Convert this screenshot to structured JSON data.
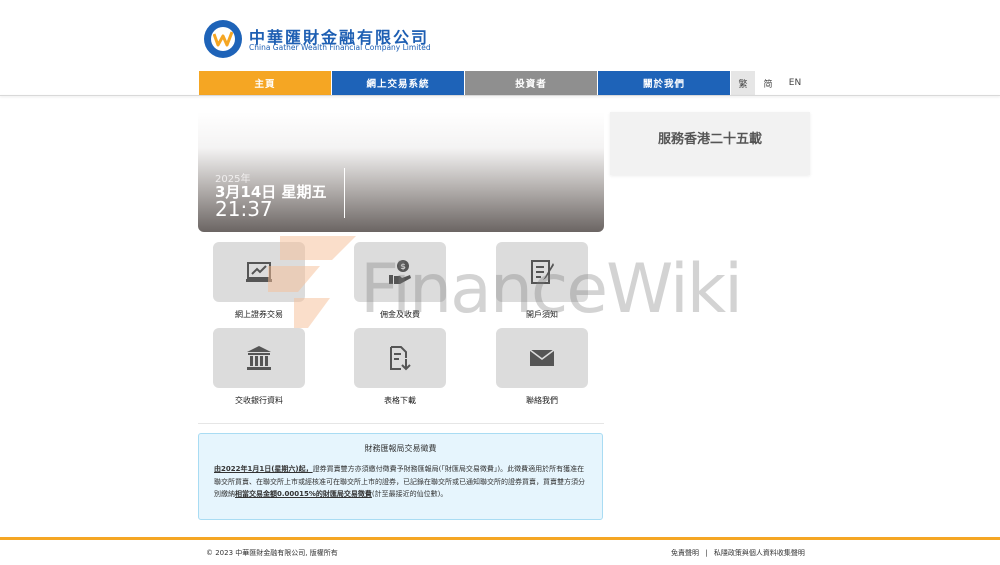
{
  "header": {
    "company_cn": "中華匯財金融有限公司",
    "company_en": "China Gather Wealth Financial Company Limited"
  },
  "nav": {
    "items": [
      {
        "label": "主頁",
        "color": "#f5a623"
      },
      {
        "label": "網上交易系統",
        "color": "#1e63b8"
      },
      {
        "label": "投資者",
        "color": "#8f8f8f"
      },
      {
        "label": "關於我們",
        "color": "#1e63b8"
      }
    ],
    "languages": [
      "繁",
      "简",
      "EN"
    ]
  },
  "hero": {
    "year": "2025年",
    "date": "3月14日 星期五",
    "time": "21:37"
  },
  "side": {
    "title": "服務香港二十五載"
  },
  "quicklinks": [
    {
      "label": "網上證券交易",
      "icon": "chart-trend-icon"
    },
    {
      "label": "佣金及收費",
      "icon": "money-hand-icon"
    },
    {
      "label": "開戶須知",
      "icon": "document-edit-icon"
    },
    {
      "label": "交收銀行資料",
      "icon": "bank-icon"
    },
    {
      "label": "表格下載",
      "icon": "file-download-icon"
    },
    {
      "label": "聯絡我們",
      "icon": "envelope-icon"
    }
  ],
  "notice": {
    "title": "財務匯報局交易徵費",
    "body_prefix": "由2022年1月1日(星期六)起，",
    "body_main": "證券買賣雙方亦須繳付徵費予財務匯報局(「財匯局交易徵費」)。此徵費適用於所有獲准在聯交所買賣、在聯交所上市或經核准可在聯交所上市的證券，已記錄在聯交所或已通知聯交所的證券買賣，買賣雙方須分別繳納",
    "body_highlight": "相當交易金額0.00015%的財匯局交易徵費",
    "body_suffix": "(計至最接近的仙位數)。"
  },
  "watermark": "FinanceWiki",
  "footer": {
    "copyright": "© 2023 中華匯財金融有限公司, 版權所有",
    "link_disclaimer": "免責聲明",
    "separator": "|",
    "link_privacy": "私隱政策與個人資料收集聲明"
  }
}
